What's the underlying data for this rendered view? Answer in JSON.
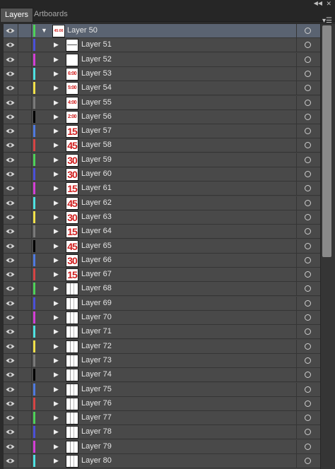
{
  "panel": {
    "collapse_icon": "double-chevron-left-icon",
    "close_icon": "close-icon",
    "menu_icon": "panel-menu-icon",
    "tabs": [
      {
        "label": "Layers",
        "active": true
      },
      {
        "label": "Artboards",
        "active": false
      }
    ]
  },
  "layers": [
    {
      "name": "Layer 50",
      "color": "#4fd159",
      "expanded": true,
      "level": 0,
      "thumb": {
        "kind": "tiny",
        "text": "45:00"
      }
    },
    {
      "name": "Layer 51",
      "color": "#4b50d8",
      "expanded": false,
      "level": 1,
      "thumb": {
        "kind": "line",
        "text": ""
      }
    },
    {
      "name": "Layer 52",
      "color": "#d33fd6",
      "expanded": false,
      "level": 1,
      "thumb": {
        "kind": "blank",
        "text": ""
      }
    },
    {
      "name": "Layer 53",
      "color": "#4ee1e1",
      "expanded": false,
      "level": 1,
      "thumb": {
        "kind": "small",
        "text": "6:00"
      }
    },
    {
      "name": "Layer 54",
      "color": "#f0e04a",
      "expanded": false,
      "level": 1,
      "thumb": {
        "kind": "small",
        "text": "5:00"
      }
    },
    {
      "name": "Layer 55",
      "color": "#7a7a7a",
      "expanded": false,
      "level": 1,
      "thumb": {
        "kind": "small",
        "text": "4:00"
      }
    },
    {
      "name": "Layer 56",
      "color": "#000000",
      "expanded": false,
      "level": 1,
      "thumb": {
        "kind": "small",
        "text": "2:00"
      }
    },
    {
      "name": "Layer 57",
      "color": "#4f7ae0",
      "expanded": false,
      "level": 1,
      "thumb": {
        "kind": "big",
        "text": "15"
      }
    },
    {
      "name": "Layer 58",
      "color": "#d64444",
      "expanded": false,
      "level": 1,
      "thumb": {
        "kind": "big",
        "text": "45"
      }
    },
    {
      "name": "Layer 59",
      "color": "#4fd159",
      "expanded": false,
      "level": 1,
      "thumb": {
        "kind": "big",
        "text": "30"
      }
    },
    {
      "name": "Layer 60",
      "color": "#4b50d8",
      "expanded": false,
      "level": 1,
      "thumb": {
        "kind": "big",
        "text": "30"
      }
    },
    {
      "name": "Layer 61",
      "color": "#d33fd6",
      "expanded": false,
      "level": 1,
      "thumb": {
        "kind": "big",
        "text": "15"
      }
    },
    {
      "name": "Layer 62",
      "color": "#4ee1e1",
      "expanded": false,
      "level": 1,
      "thumb": {
        "kind": "big",
        "text": "45"
      }
    },
    {
      "name": "Layer 63",
      "color": "#f0e04a",
      "expanded": false,
      "level": 1,
      "thumb": {
        "kind": "big",
        "text": "30"
      }
    },
    {
      "name": "Layer 64",
      "color": "#7a7a7a",
      "expanded": false,
      "level": 1,
      "thumb": {
        "kind": "big",
        "text": "15"
      }
    },
    {
      "name": "Layer 65",
      "color": "#000000",
      "expanded": false,
      "level": 1,
      "thumb": {
        "kind": "big",
        "text": "45"
      }
    },
    {
      "name": "Layer 66",
      "color": "#4f7ae0",
      "expanded": false,
      "level": 1,
      "thumb": {
        "kind": "big",
        "text": "30"
      }
    },
    {
      "name": "Layer 67",
      "color": "#d64444",
      "expanded": false,
      "level": 1,
      "thumb": {
        "kind": "big",
        "text": "15"
      }
    },
    {
      "name": "Layer 68",
      "color": "#4fd159",
      "expanded": false,
      "level": 1,
      "thumb": {
        "kind": "grid",
        "text": ""
      }
    },
    {
      "name": "Layer 69",
      "color": "#4b50d8",
      "expanded": false,
      "level": 1,
      "thumb": {
        "kind": "grid",
        "text": ""
      }
    },
    {
      "name": "Layer 70",
      "color": "#d33fd6",
      "expanded": false,
      "level": 1,
      "thumb": {
        "kind": "grid",
        "text": ""
      }
    },
    {
      "name": "Layer 71",
      "color": "#4ee1e1",
      "expanded": false,
      "level": 1,
      "thumb": {
        "kind": "grid",
        "text": ""
      }
    },
    {
      "name": "Layer 72",
      "color": "#f0e04a",
      "expanded": false,
      "level": 1,
      "thumb": {
        "kind": "grid",
        "text": ""
      }
    },
    {
      "name": "Layer 73",
      "color": "#7a7a7a",
      "expanded": false,
      "level": 1,
      "thumb": {
        "kind": "grid",
        "text": ""
      }
    },
    {
      "name": "Layer 74",
      "color": "#000000",
      "expanded": false,
      "level": 1,
      "thumb": {
        "kind": "grid",
        "text": ""
      }
    },
    {
      "name": "Layer 75",
      "color": "#4f7ae0",
      "expanded": false,
      "level": 1,
      "thumb": {
        "kind": "grid",
        "text": ""
      }
    },
    {
      "name": "Layer 76",
      "color": "#d64444",
      "expanded": false,
      "level": 1,
      "thumb": {
        "kind": "grid",
        "text": ""
      }
    },
    {
      "name": "Layer 77",
      "color": "#4fd159",
      "expanded": false,
      "level": 1,
      "thumb": {
        "kind": "grid",
        "text": ""
      }
    },
    {
      "name": "Layer 78",
      "color": "#4b50d8",
      "expanded": false,
      "level": 1,
      "thumb": {
        "kind": "grid",
        "text": ""
      }
    },
    {
      "name": "Layer 79",
      "color": "#d33fd6",
      "expanded": false,
      "level": 1,
      "thumb": {
        "kind": "grid",
        "text": ""
      }
    },
    {
      "name": "Layer 80",
      "color": "#4ee1e1",
      "expanded": false,
      "level": 1,
      "thumb": {
        "kind": "grid",
        "text": ""
      }
    }
  ]
}
